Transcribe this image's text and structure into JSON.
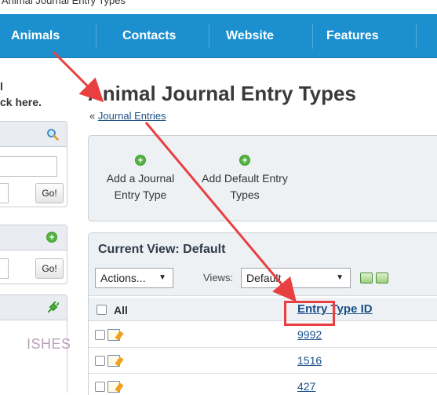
{
  "top_strip": {
    "text": "Animal Journal Entry Types"
  },
  "nav": {
    "items": [
      {
        "label": "Animals"
      },
      {
        "label": "Contacts"
      },
      {
        "label": "Website"
      },
      {
        "label": "Features"
      }
    ]
  },
  "sidebar": {
    "top_text_line1": "l",
    "top_text_line2": "ck here.",
    "go_label": "Go!",
    "big_text": "ISHES"
  },
  "page": {
    "title": "Animal Journal Entry Types",
    "breadcrumb_prefix": "«",
    "breadcrumb_link": "Journal Entries"
  },
  "actions": {
    "add_journal_entry_type": "Add a Journal Entry Type",
    "add_default_entry_types": "Add Default Entry Types"
  },
  "view": {
    "title": "Current View: Default",
    "actions_select": "Actions...",
    "views_label": "Views:",
    "views_select": "Default",
    "all_label": "All",
    "column_header": "Entry Type ID",
    "rows": [
      {
        "id": "9992",
        "highlighted": true
      },
      {
        "id": "1516"
      },
      {
        "id": "427"
      }
    ]
  },
  "annotation_color": "#e84040"
}
